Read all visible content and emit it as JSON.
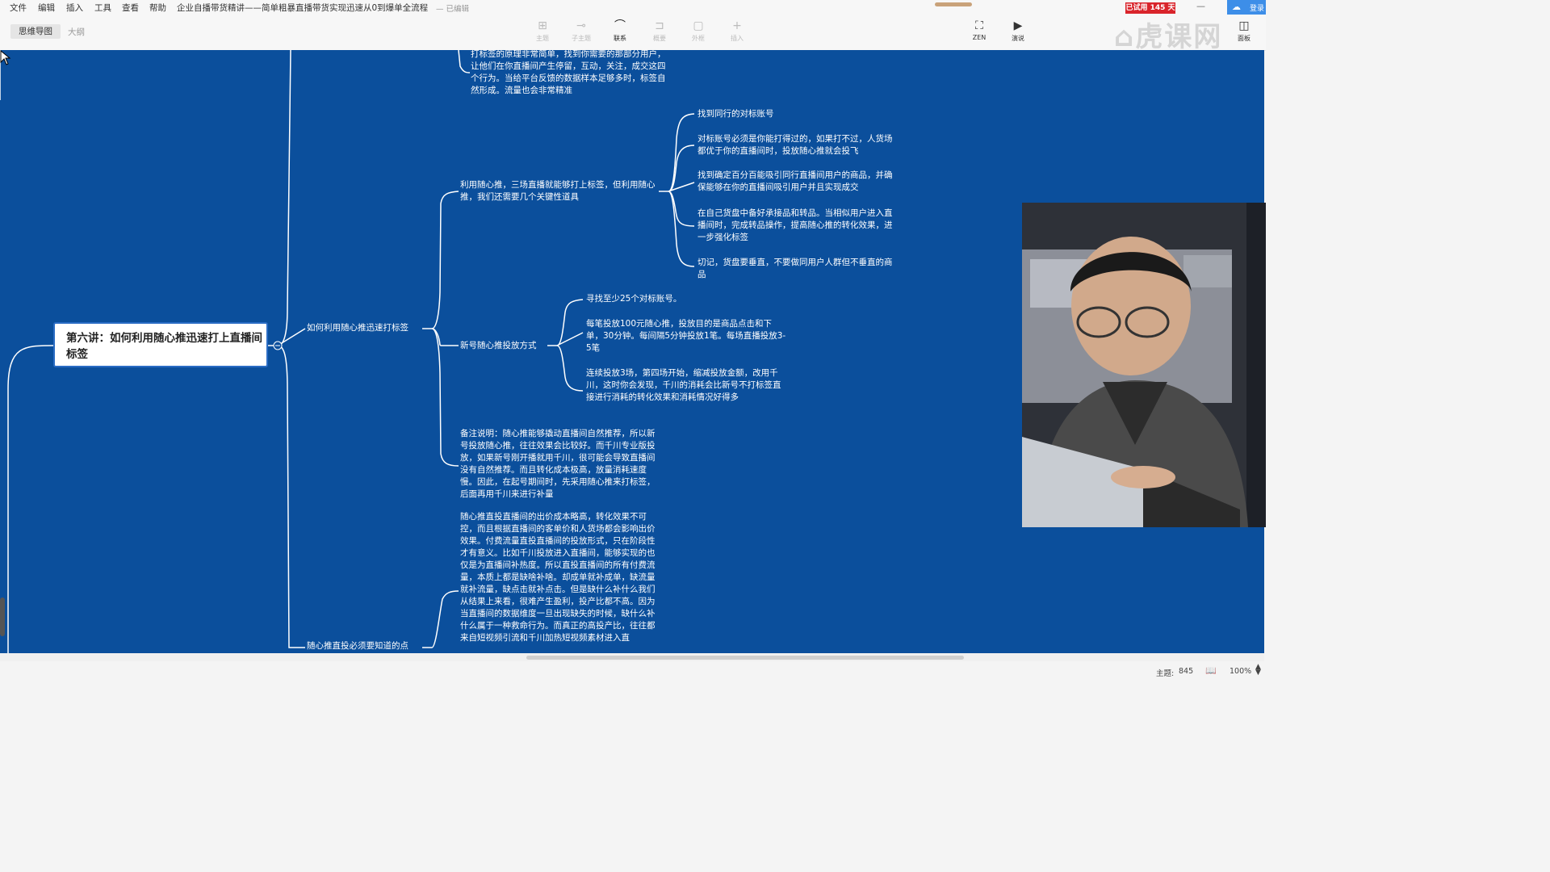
{
  "menu": {
    "items": [
      "文件",
      "编辑",
      "插入",
      "工具",
      "查看",
      "帮助"
    ],
    "doc_title": "企业自播带货精讲——简单粗暴直播带货实现迅速从0到爆单全流程",
    "status": "— 已编辑",
    "trial_badge": "已试用 145 天",
    "cloud_label": "登录"
  },
  "toolbar": {
    "tab_mindmap": "思维导图",
    "tab_outline": "大纲",
    "tools": [
      {
        "label": "主题",
        "icon": "topic-icon",
        "glyph": "⊞"
      },
      {
        "label": "子主题",
        "icon": "subtopic-icon",
        "glyph": "⊸"
      },
      {
        "label": "联系",
        "icon": "relationship-icon",
        "glyph": "⌒"
      },
      {
        "label": "概要",
        "icon": "summary-icon",
        "glyph": "⊐"
      },
      {
        "label": "外框",
        "icon": "boundary-icon",
        "glyph": "▢"
      },
      {
        "label": "插入",
        "icon": "insert-icon",
        "glyph": "+"
      }
    ],
    "zen_label": "ZEN",
    "present_label": "演说",
    "panel_label": "面板"
  },
  "mindmap": {
    "central": "第六讲：如何利用随心推迅速打上直播间标签",
    "branch_a": "如何利用随心推迅速打标签",
    "branch_b": "随心推直投必须要知道的点",
    "top_note": "打标签的原理非常简单，找到你需要的那部分用户，让他们在你直播间产生停留，互动，关注，成交这四个行为。当给平台反馈的数据样本足够多时，标签自然形成。流量也会非常精准",
    "sub1": {
      "label": "利用随心推，三场直播就能够打上标签，但利用随心推，我们还需要几个关键性道具",
      "children": [
        "找到同行的对标账号",
        "对标账号必须是你能打得过的，如果打不过，人货场都优于你的直播间时，投放随心推就会投飞",
        "找到确定百分百能吸引同行直播间用户的商品，并确保能够在你的直播间吸引用户并且实现成交",
        "在自己货盘中备好承接品和转品。当相似用户进入直播间时，完成转品操作，提高随心推的转化效果，进一步强化标签",
        "切记，货盘要垂直，不要做同用户人群但不垂直的商品"
      ]
    },
    "sub2": {
      "label": "新号随心推投放方式",
      "children": [
        "寻找至少25个对标账号。",
        "每笔投放100元随心推，投放目的是商品点击和下单，30分钟。每间隔5分钟投放1笔。每场直播投放3-5笔",
        "连续投放3场，第四场开始，缩减投放金额，改用千川，这时你会发现，千川的消耗会比新号不打标签直接进行消耗的转化效果和消耗情况好得多"
      ]
    },
    "note": "备注说明：随心推能够撬动直播间自然推荐，所以新号投放随心推，往往效果会比较好。而千川专业版投放，如果新号刚开播就用千川，很可能会导致直播间没有自然推荐。而且转化成本极高，放量消耗速度慢。因此，在起号期间时，先采用随心推来打标签，后面再用千川来进行补量",
    "direct": "随心推直投直播间的出价成本略高，转化效果不可控，而且根据直播间的客单价和人货场都会影响出价效果。付费流量直投直播间的投放形式，只在阶段性才有意义。比如千川投放进入直播间，能够实现的也仅是为直播间补热度。所以直投直播间的所有付费流量，本质上都是缺啥补啥。却成单就补成单，缺流量就补流量，缺点击就补点击。但是缺什么补什么我们从结果上来看，很难产生盈利，投产比都不高。因为当直播间的数据维度一旦出现缺失的时候，缺什么补什么属于一种救命行为。而真正的高投产比，往往都来自短视频引流和千川加热短视频素材进入直"
  },
  "status": {
    "topic_label": "主题:",
    "topic_count": "845",
    "zoom": "100%"
  },
  "watermark": "虎课网"
}
